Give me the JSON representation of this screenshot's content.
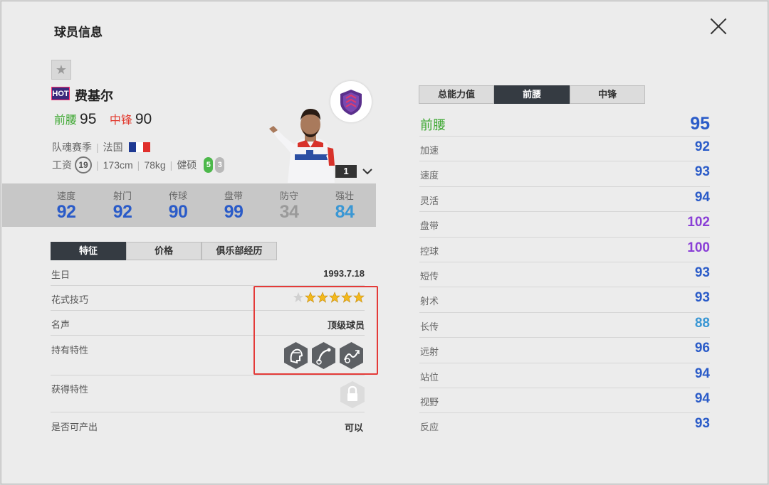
{
  "dialog": {
    "title": "球员信息"
  },
  "player": {
    "hot_badge": "HOT",
    "name": "费基尔",
    "pos1_label": "前腰",
    "pos1_value": "95",
    "pos2_label": "中锋",
    "pos2_value": "90",
    "season": "队魂赛季",
    "nation": "法国",
    "wage_label": "工资",
    "wage": "19",
    "height": "173cm",
    "weight": "78kg",
    "physique": "健硕",
    "left_foot": "5",
    "right_foot": "3",
    "level": "1"
  },
  "summary_stats": [
    {
      "label": "速度",
      "value": "92",
      "color": "#2a5bc8"
    },
    {
      "label": "射门",
      "value": "92",
      "color": "#2a5bc8"
    },
    {
      "label": "传球",
      "value": "90",
      "color": "#2a5bc8"
    },
    {
      "label": "盘带",
      "value": "99",
      "color": "#2a5bc8"
    },
    {
      "label": "防守",
      "value": "34",
      "color": "#9a9a9a"
    },
    {
      "label": "强壮",
      "value": "84",
      "color": "#3a97d4"
    }
  ],
  "left_tabs": [
    "特征",
    "价格",
    "俱乐部经历"
  ],
  "features": {
    "birthday_label": "生日",
    "birthday": "1993.7.18",
    "skill_moves_label": "花式技巧",
    "skill_moves_stars": 5,
    "reputation_label": "名声",
    "reputation": "顶级球员",
    "traits_label": "持有特性",
    "earned_traits_label": "获得特性",
    "producible_label": "是否可产出",
    "producible": "可以"
  },
  "right_tabs": [
    "总能力值",
    "前腰",
    "中锋"
  ],
  "position_rating": {
    "label": "前腰",
    "value": "95"
  },
  "attributes": [
    {
      "label": "加速",
      "value": "92",
      "color": "#2a5bc8"
    },
    {
      "label": "速度",
      "value": "93",
      "color": "#2a5bc8"
    },
    {
      "label": "灵活",
      "value": "94",
      "color": "#2a5bc8"
    },
    {
      "label": "盘带",
      "value": "102",
      "color": "#8a3fd6"
    },
    {
      "label": "控球",
      "value": "100",
      "color": "#8a3fd6"
    },
    {
      "label": "短传",
      "value": "93",
      "color": "#2a5bc8"
    },
    {
      "label": "射术",
      "value": "93",
      "color": "#2a5bc8"
    },
    {
      "label": "长传",
      "value": "88",
      "color": "#3a97d4"
    },
    {
      "label": "远射",
      "value": "96",
      "color": "#2a5bc8"
    },
    {
      "label": "站位",
      "value": "94",
      "color": "#2a5bc8"
    },
    {
      "label": "视野",
      "value": "94",
      "color": "#2a5bc8"
    },
    {
      "label": "反应",
      "value": "93",
      "color": "#2a5bc8"
    }
  ],
  "colors": {
    "accent_dark": "#353b42",
    "cam_green": "#3ea832",
    "st_red": "#e23b30",
    "highlight_red": "#e43a38"
  }
}
